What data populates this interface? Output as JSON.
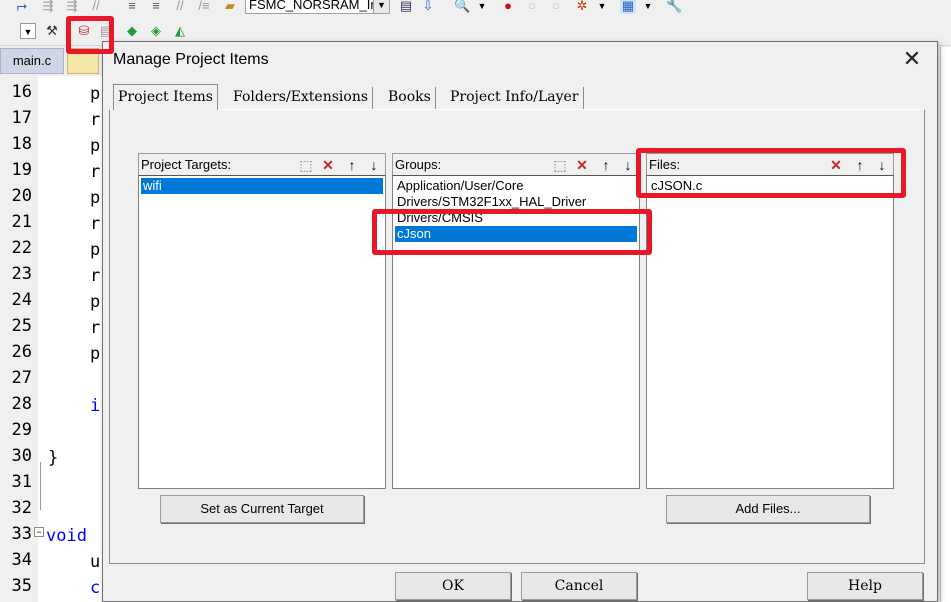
{
  "ide": {
    "project_combo": "FSMC_NORSRAM_Ir",
    "file_tab": "main.c",
    "line_numbers": [
      "16",
      "17",
      "18",
      "19",
      "20",
      "21",
      "22",
      "23",
      "24",
      "25",
      "26",
      "27",
      "28",
      "29",
      "30",
      "31",
      "32",
      "33",
      "34",
      "35"
    ],
    "code_fragments": {
      "l16": "p",
      "l17": "r",
      "l18": "p",
      "l19": "r",
      "l20": "p",
      "l21": "r",
      "l22": "p",
      "l23": "r",
      "l24": "p",
      "l25": "r",
      "l26": "p",
      "l28": "i",
      "l30": "}",
      "l33": "void",
      "l34": "u",
      "l35": "c"
    }
  },
  "dialog": {
    "title": "Manage Project Items",
    "tabs": [
      "Project Items",
      "Folders/Extensions",
      "Books",
      "Project Info/Layer"
    ],
    "targets": {
      "label": "Project Targets:",
      "items": [
        "wifi"
      ],
      "selected": "wifi",
      "button": "Set as Current Target"
    },
    "groups": {
      "label": "Groups:",
      "items": [
        "Application/User/Core",
        "Drivers/STM32F1xx_HAL_Driver",
        "Drivers/CMSIS",
        "cJson"
      ],
      "selected": "cJson"
    },
    "files": {
      "label": "Files:",
      "items": [
        "cJSON.c"
      ],
      "button": "Add Files..."
    },
    "buttons": {
      "ok": "OK",
      "cancel": "Cancel",
      "help": "Help"
    }
  },
  "colors": {
    "selection": "#0078d7",
    "highlight_box": "#e8182a",
    "keyword": "#0000ff"
  }
}
